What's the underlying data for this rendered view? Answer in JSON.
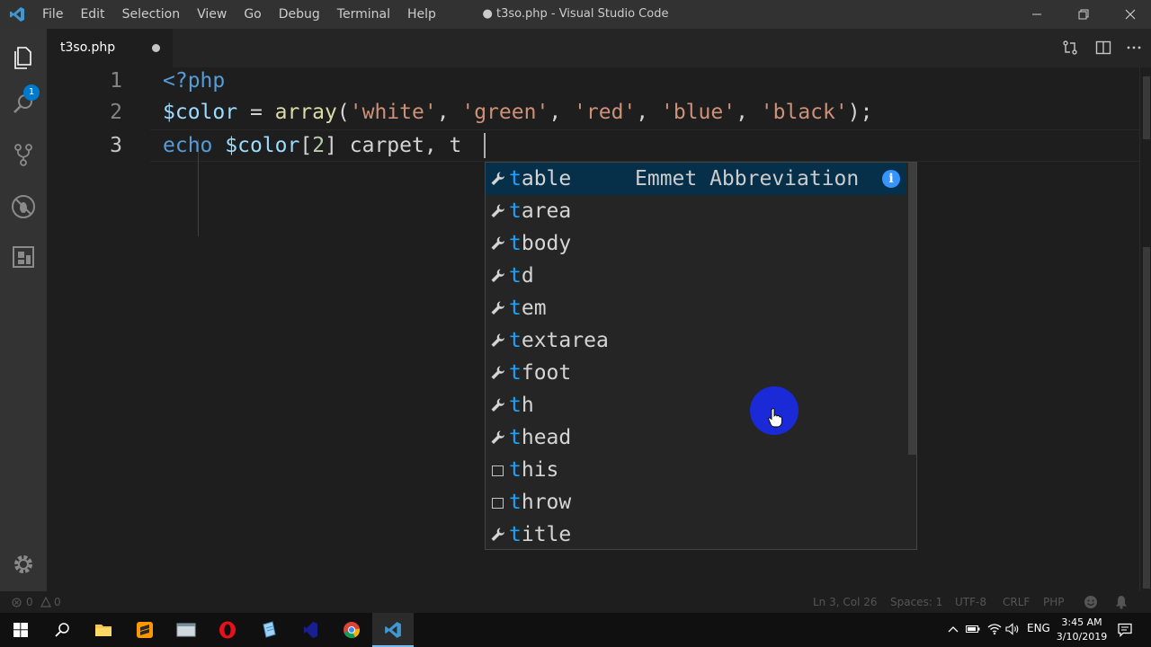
{
  "window": {
    "title": "● t3so.php - Visual Studio Code",
    "menu": [
      "File",
      "Edit",
      "Selection",
      "View",
      "Go",
      "Debug",
      "Terminal",
      "Help"
    ]
  },
  "activity": {
    "explorer_badge": "1",
    "icons": [
      "files-icon",
      "search-icon",
      "source-control-icon",
      "debug-icon",
      "extensions-icon",
      "settings-gear-icon"
    ]
  },
  "tab": {
    "label": "t3so.php"
  },
  "editor": {
    "lines": [
      {
        "number": "1",
        "text": "<?php"
      },
      {
        "number": "2",
        "text": "$color = array('white', 'green', 'red', 'blue', 'black');"
      },
      {
        "number": "3",
        "text": "echo $color[2] carpet, t"
      }
    ],
    "colors": {
      "keyword": "#569cd6",
      "variable": "#9cdcfe",
      "string": "#ce9178",
      "function": "#dcdcaa",
      "number": "#b5cea8",
      "match": "#18a3ff"
    }
  },
  "suggest": {
    "detail": "Emmet Abbreviation",
    "items": [
      {
        "label": "table",
        "icon": "wrench-icon"
      },
      {
        "label": "tarea",
        "icon": "wrench-icon"
      },
      {
        "label": "tbody",
        "icon": "wrench-icon"
      },
      {
        "label": "td",
        "icon": "wrench-icon"
      },
      {
        "label": "tem",
        "icon": "wrench-icon"
      },
      {
        "label": "textarea",
        "icon": "wrench-icon"
      },
      {
        "label": "tfoot",
        "icon": "wrench-icon"
      },
      {
        "label": "th",
        "icon": "wrench-icon"
      },
      {
        "label": "thead",
        "icon": "wrench-icon"
      },
      {
        "label": "this",
        "icon": "keyword-icon"
      },
      {
        "label": "throw",
        "icon": "keyword-icon"
      },
      {
        "label": "title",
        "icon": "wrench-icon"
      }
    ]
  },
  "status": {
    "errors": "0",
    "warnings": "0",
    "position": "Ln 3, Col 26",
    "spaces": "Spaces: 1",
    "encoding": "UTF-8",
    "eol": "CRLF",
    "language": "PHP"
  },
  "taskbar": {
    "lang": "ENG",
    "time": "3:45 AM",
    "date": "3/10/2019"
  }
}
